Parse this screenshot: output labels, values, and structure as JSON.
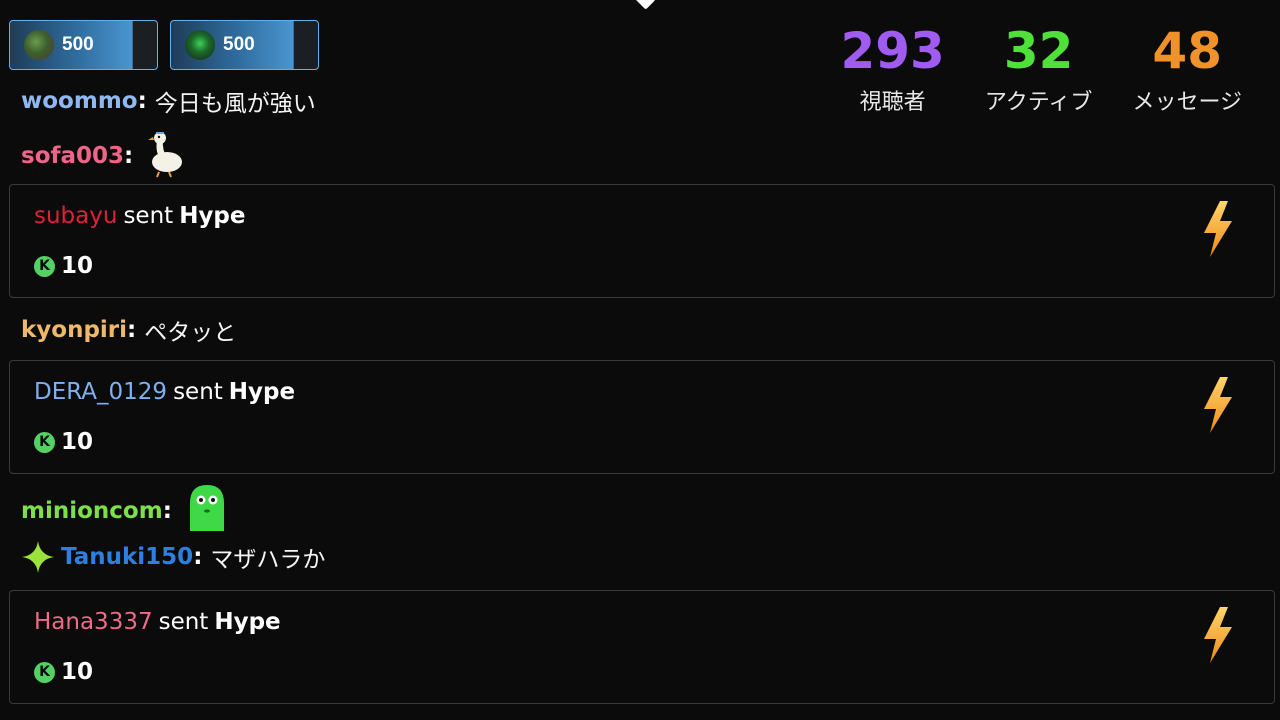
{
  "badges": [
    {
      "amount": "500",
      "avatar": "user-avatar-icon"
    },
    {
      "amount": "500",
      "avatar": "green-avatar-icon"
    }
  ],
  "stats": [
    {
      "value": "293",
      "label": "視聴者",
      "color": "#a05cf0"
    },
    {
      "value": "32",
      "label": "アクティブ",
      "color": "#4fe03a"
    },
    {
      "value": "48",
      "label": "メッセージ",
      "color": "#f0922a"
    }
  ],
  "chat": [
    {
      "user": "woommo",
      "user_color": "#8fb8f0",
      "message": "今日も風が強い"
    },
    {
      "user": "sofa003",
      "user_color": "#f0648a",
      "emote": "goose-emote-icon"
    },
    {
      "user": "kyonpiri",
      "user_color": "#f0b86a",
      "message": "ペタッと"
    },
    {
      "user": "minioncom",
      "user_color": "#7ce04a",
      "emote": "green-blob-emote-icon"
    },
    {
      "user": "Tanuki150",
      "user_color": "#2f7fe0",
      "message": "マザハラか",
      "badge": "sparkle-icon"
    }
  ],
  "hype": [
    {
      "user": "subayu",
      "user_color": "#e0203a",
      "sent": "sent",
      "gift": "Hype",
      "amount": "10"
    },
    {
      "user": "DERA_0129",
      "user_color": "#7fb0f0",
      "sent": "sent",
      "gift": "Hype",
      "amount": "10"
    },
    {
      "user": "Hana3337",
      "user_color": "#f06a8a",
      "sent": "sent",
      "gift": "Hype",
      "amount": "10"
    }
  ],
  "icons": {
    "coin": "k-coin-icon",
    "hype": "lightning-bolt-icon"
  },
  "colors": {
    "background": "#0b0b0c",
    "card_border": "#3a3a3d",
    "badge_border": "#5fb2ee"
  }
}
